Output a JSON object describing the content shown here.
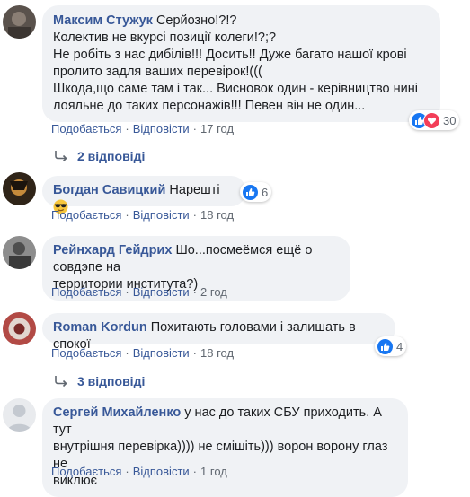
{
  "colors": {
    "author": "#385898",
    "bubble": "#f0f2f5",
    "meta": "#606770",
    "like": "#1877f2",
    "love": "#f33e58"
  },
  "comments": [
    {
      "author": "Максим Стужук",
      "lines": [
        "Серйозно!?!?",
        "Колектив не вкурсі позиції колеги!?;?",
        "Не робіть з нас дибілів!!! Досить!! Дуже багато нашої крові",
        "пролито задля ваших перевірок!(((",
        "Шкода,що саме там і так... Висновок один - керівництво нині",
        "лояльне до таких персонажів!!! Певен він не один..."
      ],
      "like_label": "Подобається",
      "reply_label": "Відповісти",
      "time": "17 год",
      "reactions": {
        "icons": [
          "like-icon",
          "love-icon"
        ],
        "count": "30"
      }
    },
    {
      "author": "Богдан Савицкий",
      "text": "Нарешті",
      "emoji": "sunglasses-emoji",
      "like_label": "Подобається",
      "reply_label": "Відповісти",
      "time": "18 год",
      "reactions": {
        "icons": [
          "like-icon"
        ],
        "count": "6"
      }
    },
    {
      "author": "Рейнхард Гейдрих",
      "lines": [
        "Шо...посмеёмся ещё о совдэпе на",
        "территории института?)"
      ],
      "like_label": "Подобається",
      "reply_label": "Відповісти",
      "time": "2 год"
    },
    {
      "author": "Roman Kordun",
      "text": "Похитають головами і залишать в спокої",
      "like_label": "Подобається",
      "reply_label": "Відповісти",
      "time": "18 год",
      "reactions": {
        "icons": [
          "like-icon"
        ],
        "count": "4"
      }
    },
    {
      "author": "Сергей Михайленко",
      "lines": [
        "у нас до таких СБУ приходить. А тут",
        "внутрішня перевірка)))) не смішіть))) ворон ворону глаз не",
        "виклює"
      ],
      "like_label": "Подобається",
      "reply_label": "Відповісти",
      "time": "1 год"
    }
  ],
  "reply_threads": [
    {
      "label": "2 відповіді"
    },
    {
      "label": "3 відповіді"
    }
  ]
}
